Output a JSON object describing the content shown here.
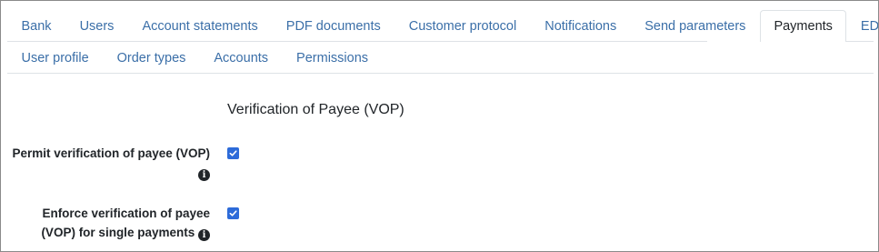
{
  "tabs_row1": [
    "Bank",
    "Users",
    "Account statements",
    "PDF documents",
    "Customer protocol",
    "Notifications",
    "Send parameters",
    "Payments",
    "EDS"
  ],
  "tabs_row2": [
    "User profile",
    "Order types",
    "Accounts",
    "Permissions"
  ],
  "active_tab": "Payments",
  "section": {
    "title": "Verification of Payee (VOP)"
  },
  "fields": {
    "permit": {
      "label": "Permit verification of payee (VOP)",
      "checked": true
    },
    "enforce": {
      "label_line1": "Enforce verification of payee",
      "label_line2": "(VOP) for single payments",
      "checked": true
    }
  },
  "icons": {
    "info": "info-icon",
    "check": "checkmark-icon"
  },
  "colors": {
    "link": "#3b6fa8",
    "checkbox": "#2d6bd9",
    "border": "#dee2e6"
  }
}
